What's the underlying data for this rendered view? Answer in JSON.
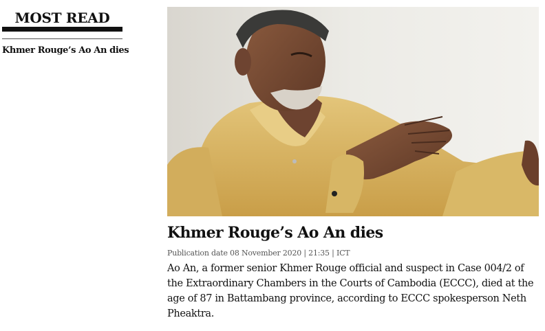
{
  "sidebar": {
    "heading": "MOST READ",
    "items": [
      {
        "title": "Khmer Rouge’s Ao An dies"
      }
    ]
  },
  "article": {
    "headline": "Khmer Rouge’s Ao An dies",
    "meta": "Publication date 08 November 2020 | 21:35 | ICT",
    "summary": "Ao An, a former senior Khmer Rouge official and suspect in Case 004/2 of the Extraordinary Chambers in the Courts of Cambodia (ECCC), died at the age of 87 in Battambang province, according to ECCC spokesperson Neth Pheaktra.",
    "image": {
      "description_icon": "photo"
    }
  },
  "colors": {
    "text": "#111111",
    "meta": "#555555",
    "shirt": "#d9b45e",
    "background": "#ffffff"
  }
}
